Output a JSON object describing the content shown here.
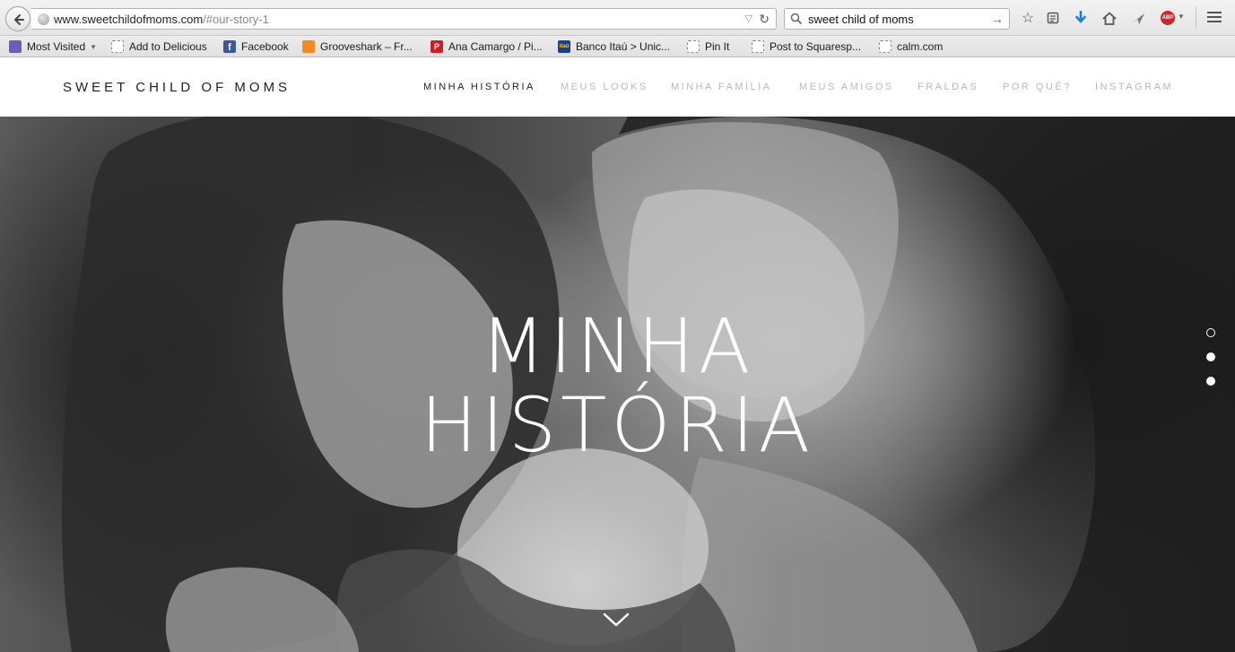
{
  "browser": {
    "url_host": "www.sweetchildofmoms.com",
    "url_path": "/#our-story-1",
    "search_query": "sweet child of moms",
    "adblock_label": "ABP",
    "bookmarks": [
      {
        "label": "Most Visited",
        "icon": "most-visited-icon"
      },
      {
        "label": "Add to Delicious",
        "icon": "bookmarklet-icon"
      },
      {
        "label": "Facebook",
        "icon": "facebook-icon"
      },
      {
        "label": "Grooveshark – Fr...",
        "icon": "grooveshark-icon"
      },
      {
        "label": "Ana Camargo / Pi...",
        "icon": "pinterest-icon"
      },
      {
        "label": "Banco Itaú > Unic...",
        "icon": "itau-icon"
      },
      {
        "label": "Pin It",
        "icon": "bookmarklet-icon"
      },
      {
        "label": "Post to Squaresp...",
        "icon": "bookmarklet-icon"
      },
      {
        "label": "calm.com",
        "icon": "bookmarklet-icon"
      }
    ]
  },
  "site": {
    "title": "SWEET CHILD OF MOMS",
    "nav": [
      {
        "label": "MINHA HISTÓRIA",
        "active": true
      },
      {
        "label": "MEUS LOOKS",
        "active": false
      },
      {
        "label": "MINHA FAMÍLIA",
        "active": false
      },
      {
        "label": "MEUS AMIGOS",
        "active": false
      },
      {
        "label": "FRALDAS",
        "active": false
      },
      {
        "label": "POR QUÊ?",
        "active": false
      },
      {
        "label": "INSTAGRAM",
        "active": false
      }
    ]
  },
  "hero": {
    "title_line1": "MINHA",
    "title_line2": "HISTÓRIA",
    "slide_dots": 3,
    "active_dot": 1
  },
  "colors": {
    "nav_active": "#222222",
    "nav_inactive": "#b9b9b9",
    "hero_text": "#ffffff"
  }
}
